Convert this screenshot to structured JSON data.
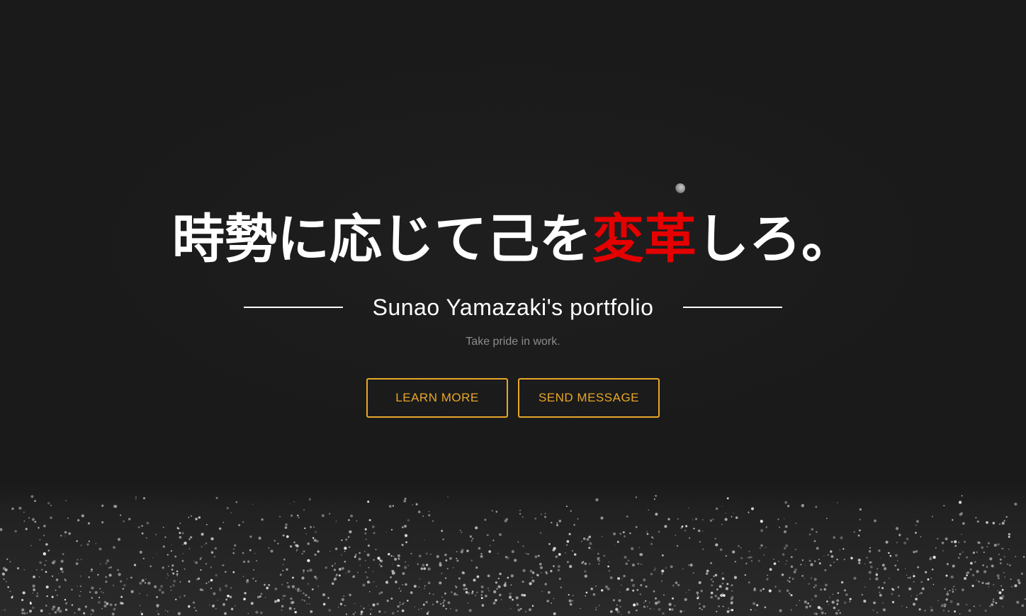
{
  "hero": {
    "headline_before": "時勢に応じて己を",
    "headline_accent": "変革",
    "headline_after": "しろ。",
    "subtitle": "Sunao Yamazaki's portfolio",
    "tagline": "Take pride in work.",
    "buttons": {
      "learn_more": "LEARN MORE",
      "send_message": "SEND MESSAGE"
    }
  },
  "colors": {
    "background": "#1a1a1a",
    "headline": "#ffffff",
    "accent": "#e50000",
    "button": "#e8a72a",
    "tagline": "#8c8c8c"
  }
}
